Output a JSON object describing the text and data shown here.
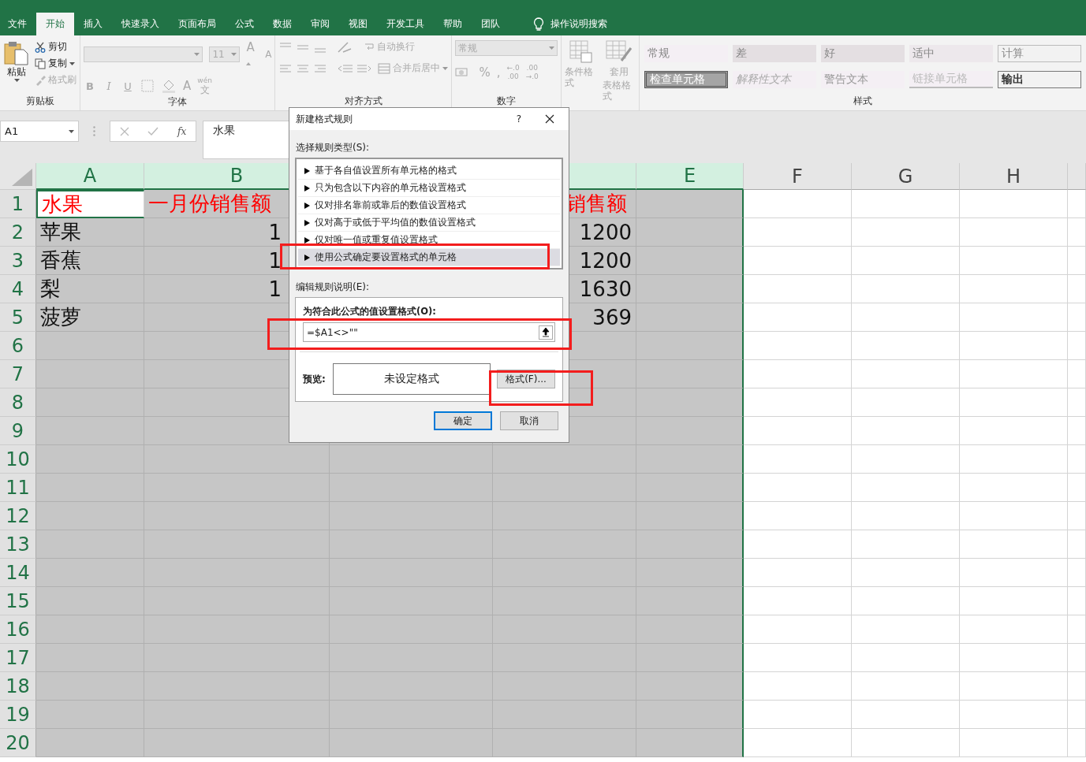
{
  "menu_tabs": [
    {
      "label": "文件",
      "selected": false
    },
    {
      "label": "开始",
      "selected": true
    },
    {
      "label": "插入",
      "selected": false
    },
    {
      "label": "快速录入",
      "selected": false
    },
    {
      "label": "页面布局",
      "selected": false
    },
    {
      "label": "公式",
      "selected": false
    },
    {
      "label": "数据",
      "selected": false
    },
    {
      "label": "审阅",
      "selected": false
    },
    {
      "label": "视图",
      "selected": false
    },
    {
      "label": "开发工具",
      "selected": false
    },
    {
      "label": "帮助",
      "selected": false
    },
    {
      "label": "团队",
      "selected": false
    }
  ],
  "tell_me": "操作说明搜索",
  "ribbon": {
    "clipboard": {
      "paste": "粘贴",
      "cut": "剪切",
      "copy": "复制",
      "format_painter": "格式刷",
      "label": "剪贴板"
    },
    "font": {
      "size": "11",
      "grow": "A",
      "shrink": "A",
      "bold": "B",
      "italic": "I",
      "underline": "U",
      "font_color": "A",
      "phonetic_top": "wén",
      "phonetic_bottom": "文",
      "label": "字体"
    },
    "alignment": {
      "wrap": "自动换行",
      "merge": "合并后居中",
      "label": "对齐方式"
    },
    "number": {
      "format": "常规",
      "percent": "%",
      "comma": ",",
      "decimals": [
        {
          "top": "←.0",
          "bottom": ".00"
        },
        {
          "top": ".00",
          "bottom": "→.0"
        }
      ],
      "label": "数字"
    },
    "conditional_format": "条件格式",
    "table_format": [
      "套用",
      "表格格式"
    ],
    "cell_styles": [
      {
        "label": "常规",
        "kind": "normal"
      },
      {
        "label": "差",
        "kind": "bad"
      },
      {
        "label": "好",
        "kind": "good"
      },
      {
        "label": "适中",
        "kind": "neutral"
      },
      {
        "label": "计算",
        "kind": "calc"
      },
      {
        "label": "检查单元格",
        "kind": "check"
      },
      {
        "label": "解释性文本",
        "kind": "explanatory"
      },
      {
        "label": "警告文本",
        "kind": "warning"
      },
      {
        "label": "链接单元格",
        "kind": "linked"
      },
      {
        "label": "输出",
        "kind": "output"
      }
    ],
    "styles_label": "样式"
  },
  "formula_bar": {
    "name_box": "A1",
    "fx": "fx",
    "value": "水果"
  },
  "sheet": {
    "columns": [
      {
        "label": "A",
        "selected": true
      },
      {
        "label": "B",
        "selected": true
      },
      {
        "selected": true
      },
      {
        "selected": true
      },
      {
        "label": "E",
        "selected": true
      },
      {
        "label": "F",
        "selected": false
      },
      {
        "label": "G",
        "selected": false
      },
      {
        "label": "H",
        "selected": false
      }
    ],
    "rows": [
      {
        "number": "1",
        "selected": true,
        "kind": "heading",
        "cells": [
          {
            "text": "水果",
            "active": true
          },
          {
            "text": "一月份销售额",
            "active": false
          },
          {},
          {
            "text": "销售额",
            "active": false
          }
        ]
      },
      {
        "number": "2",
        "selected": true,
        "kind": "data",
        "cells": [
          {
            "text": "苹果"
          },
          {
            "text": "1"
          },
          {},
          {
            "text": "1200"
          }
        ]
      },
      {
        "number": "3",
        "selected": true,
        "kind": "data",
        "cells": [
          {
            "text": "香蕉"
          },
          {
            "text": "1"
          },
          {},
          {
            "text": "1200"
          }
        ]
      },
      {
        "number": "4",
        "selected": true,
        "kind": "data",
        "cells": [
          {
            "text": "梨"
          },
          {
            "text": "1"
          },
          {},
          {
            "text": "1630"
          }
        ]
      },
      {
        "number": "5",
        "selected": true,
        "kind": "data",
        "cells": [
          {
            "text": "菠萝"
          },
          {},
          {},
          {
            "text": "369"
          }
        ]
      },
      {
        "number": "6",
        "selected": true,
        "kind": "data"
      },
      {
        "number": "7",
        "selected": true,
        "kind": "data"
      },
      {
        "number": "8",
        "selected": true,
        "kind": "data"
      },
      {
        "number": "9",
        "selected": true,
        "kind": "data"
      },
      {
        "number": "10",
        "selected": true,
        "kind": "data"
      },
      {
        "number": "11",
        "selected": true,
        "kind": "data"
      },
      {
        "number": "12",
        "selected": true,
        "kind": "data"
      },
      {
        "number": "13",
        "selected": true,
        "kind": "data"
      },
      {
        "number": "14",
        "selected": true,
        "kind": "data"
      },
      {
        "number": "15",
        "selected": true,
        "kind": "data"
      },
      {
        "number": "16",
        "selected": true,
        "kind": "data"
      },
      {
        "number": "17",
        "selected": true,
        "kind": "data"
      },
      {
        "number": "18",
        "selected": true,
        "kind": "data"
      },
      {
        "number": "19",
        "selected": true,
        "kind": "data"
      },
      {
        "number": "20",
        "selected": true,
        "kind": "data"
      }
    ]
  },
  "dialog": {
    "title": "新建格式规则",
    "help": "?",
    "rule_type_label": "选择规则类型(S):",
    "rule_types": [
      {
        "label": "基于各自值设置所有单元格的格式",
        "selected": false
      },
      {
        "label": "只为包含以下内容的单元格设置格式",
        "selected": false
      },
      {
        "label": "仅对排名靠前或靠后的数值设置格式",
        "selected": false
      },
      {
        "label": "仅对高于或低于平均值的数值设置格式",
        "selected": false
      },
      {
        "label": "仅对唯一值或重复值设置格式",
        "selected": false
      },
      {
        "label": "使用公式确定要设置格式的单元格",
        "selected": true
      }
    ],
    "edit_label": "编辑规则说明(E):",
    "formula_label": "为符合此公式的值设置格式(O):",
    "formula_value": "=$A1<>\"\"",
    "preview_label": "预览:",
    "preview_text": "未设定格式",
    "format_button": "格式(F)...",
    "ok": "确定",
    "cancel": "取消"
  }
}
